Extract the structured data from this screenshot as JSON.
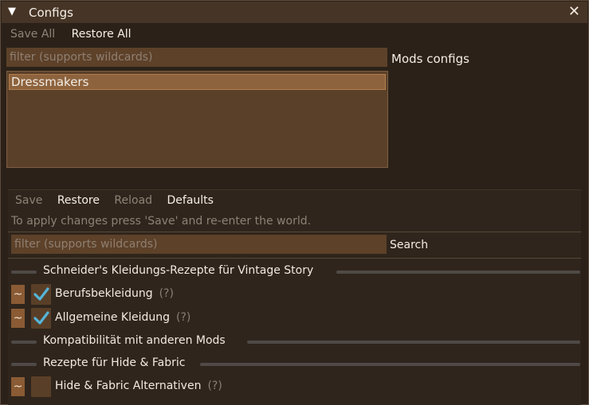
{
  "window": {
    "title": "Configs",
    "collapse_glyph": "▼",
    "close_glyph": "✕"
  },
  "top_toolbar": {
    "save_all": "Save All",
    "restore_all": "Restore All"
  },
  "mods_filter": {
    "placeholder": "filter (supports wildcards)",
    "side_label": "Mods configs"
  },
  "mods_list": {
    "items": [
      "Dressmakers"
    ]
  },
  "mod_toolbar": {
    "save": "Save",
    "restore": "Restore",
    "reload": "Reload",
    "defaults": "Defaults"
  },
  "hint": "To apply changes press 'Save' and re-enter the world.",
  "config_filter": {
    "placeholder": "filter (supports wildcards)",
    "search_label": "Search"
  },
  "sections": [
    {
      "title": "Schneider's Kleidungs-Rezepte für Vintage Story",
      "items": [
        {
          "label": "Berufsbekleidung",
          "help": "(?)",
          "checked": true,
          "reset": "~"
        },
        {
          "label": "Allgemeine Kleidung",
          "help": "(?)",
          "checked": true,
          "reset": "~"
        }
      ]
    },
    {
      "title": "Kompatibilität mit anderen Mods",
      "items": []
    },
    {
      "title": "Rezepte für Hide & Fabric",
      "items": [
        {
          "label": "Hide & Fabric Alternativen",
          "help": "(?)",
          "checked": false,
          "reset": "~"
        }
      ]
    }
  ],
  "colors": {
    "accent": "#8d633e",
    "check": "#54b5d9"
  },
  "icons": [
    "chevron-down-icon",
    "close-icon",
    "checkmark-icon"
  ]
}
